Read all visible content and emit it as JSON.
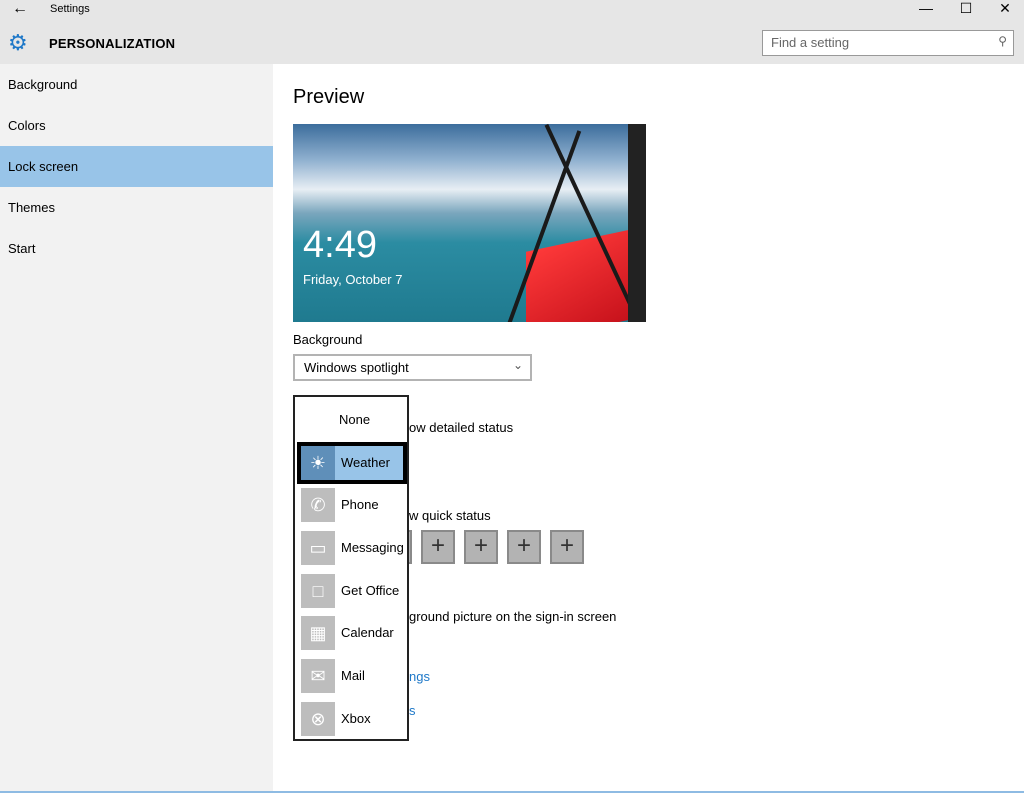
{
  "window": {
    "title": "Settings",
    "back_icon": "arrow-left",
    "minimize": "—",
    "maximize": "☐",
    "close": "✕"
  },
  "header": {
    "section": "PERSONALIZATION",
    "search_placeholder": "Find a setting"
  },
  "sidebar": {
    "items": [
      {
        "label": "Background"
      },
      {
        "label": "Colors"
      },
      {
        "label": "Lock screen",
        "selected": true
      },
      {
        "label": "Themes"
      },
      {
        "label": "Start"
      }
    ]
  },
  "main": {
    "title": "Preview",
    "preview": {
      "time": "4:49",
      "date": "Friday, October 7"
    },
    "background_label": "Background",
    "background_value": "Windows spotlight",
    "detailed_status_fragment": "ow detailed status",
    "quick_status_fragment": "w quick status",
    "signin_fragment": "ground picture on the sign-in screen",
    "link1_fragment": "ngs",
    "link2_fragment": "s",
    "plus": "+"
  },
  "popup": {
    "items": [
      {
        "label": "None"
      },
      {
        "label": "Weather",
        "selected": true,
        "icon": "☀"
      },
      {
        "label": "Phone",
        "icon": "✆"
      },
      {
        "label": "Messaging",
        "icon": "▭"
      },
      {
        "label": "Get Office",
        "icon": "□"
      },
      {
        "label": "Calendar",
        "icon": "▦"
      },
      {
        "label": "Mail",
        "icon": "✉"
      },
      {
        "label": "Xbox",
        "icon": "⊗"
      }
    ]
  }
}
